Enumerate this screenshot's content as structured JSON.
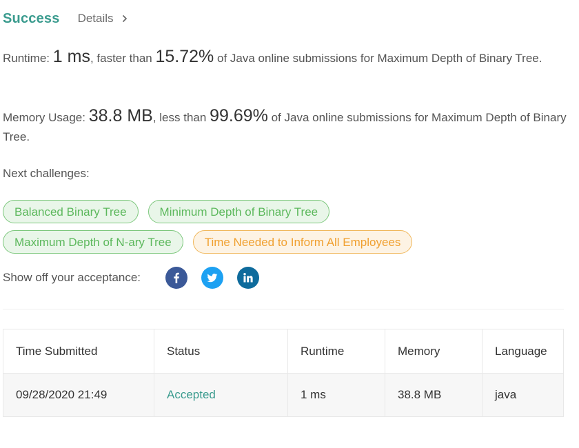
{
  "header": {
    "title": "Success",
    "details_label": "Details"
  },
  "runtime": {
    "label": "Runtime:",
    "value": "1 ms",
    "comparison": ", faster than",
    "percent": "15.72%",
    "suffix": "of Java online submissions for Maximum Depth of Binary Tree."
  },
  "memory": {
    "label": "Memory Usage:",
    "value": "38.8 MB",
    "comparison": ", less than",
    "percent": "99.69%",
    "suffix": "of Java online submissions for Maximum Depth of Binary Tree."
  },
  "next_challenges": {
    "label": "Next challenges:",
    "items": [
      {
        "label": "Balanced Binary Tree",
        "difficulty": "easy"
      },
      {
        "label": "Minimum Depth of Binary Tree",
        "difficulty": "easy"
      },
      {
        "label": "Maximum Depth of N-ary Tree",
        "difficulty": "easy"
      },
      {
        "label": "Time Needed to Inform All Employees",
        "difficulty": "medium"
      }
    ]
  },
  "share": {
    "label": "Show off your acceptance:",
    "icons": [
      "facebook-icon",
      "twitter-icon",
      "linkedin-icon"
    ]
  },
  "table": {
    "headers": [
      "Time Submitted",
      "Status",
      "Runtime",
      "Memory",
      "Language"
    ],
    "rows": [
      {
        "time": "09/28/2020 21:49",
        "status": "Accepted",
        "runtime": "1 ms",
        "memory": "38.8 MB",
        "language": "java"
      }
    ]
  },
  "colors": {
    "success": "#3a9b8e",
    "easy": "#5cb85c",
    "medium": "#f0a030",
    "facebook": "#3b5998",
    "twitter": "#1da1f2",
    "linkedin": "#0e6b9c"
  }
}
